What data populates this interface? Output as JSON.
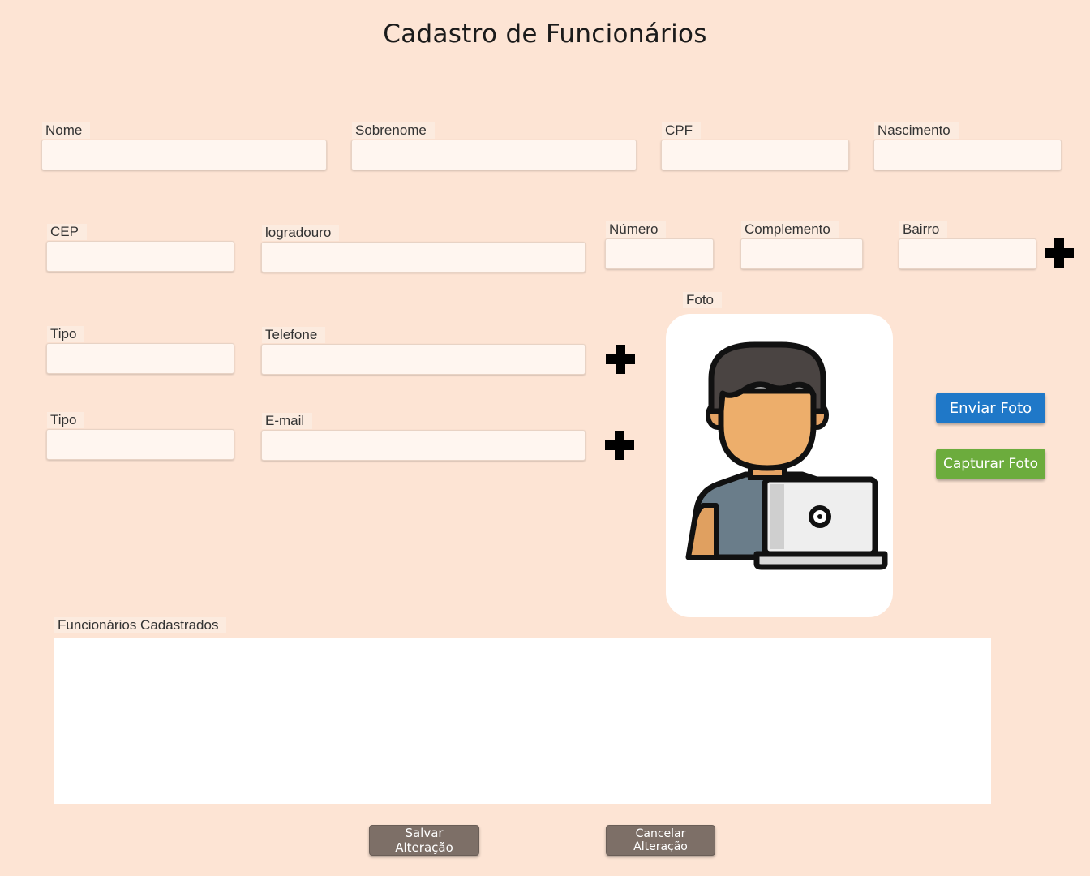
{
  "page": {
    "title": "Cadastro de Funcionários"
  },
  "fields": {
    "nome": {
      "label": "Nome",
      "value": ""
    },
    "sobrenome": {
      "label": "Sobrenome",
      "value": ""
    },
    "cpf": {
      "label": "CPF",
      "value": ""
    },
    "nascimento": {
      "label": "Nascimento",
      "value": ""
    },
    "cep": {
      "label": "CEP",
      "value": ""
    },
    "logradouro": {
      "label": "logradouro",
      "value": ""
    },
    "numero": {
      "label": "Número",
      "value": ""
    },
    "complemento": {
      "label": "Complemento",
      "value": ""
    },
    "bairro": {
      "label": "Bairro",
      "value": ""
    },
    "tipo_telefone": {
      "label": "Tipo",
      "value": ""
    },
    "telefone": {
      "label": "Telefone",
      "value": ""
    },
    "tipo_email": {
      "label": "Tipo",
      "value": ""
    },
    "email": {
      "label": "E-mail",
      "value": ""
    }
  },
  "photo": {
    "label": "Foto",
    "icon": "employee-with-laptop-icon",
    "send_label": "Enviar Foto",
    "capture_label": "Capturar Foto"
  },
  "employees": {
    "label": "Funcionários Cadastrados",
    "rows": []
  },
  "actions": {
    "save_label": "Salvar Alteração",
    "cancel_label": "Cancelar Alteração"
  },
  "icons": {
    "add": "plus-icon"
  },
  "colors": {
    "background": "#fde4d4",
    "send_button": "#1f78c8",
    "capture_button": "#6cac3d",
    "action_button": "#7d6f67"
  }
}
